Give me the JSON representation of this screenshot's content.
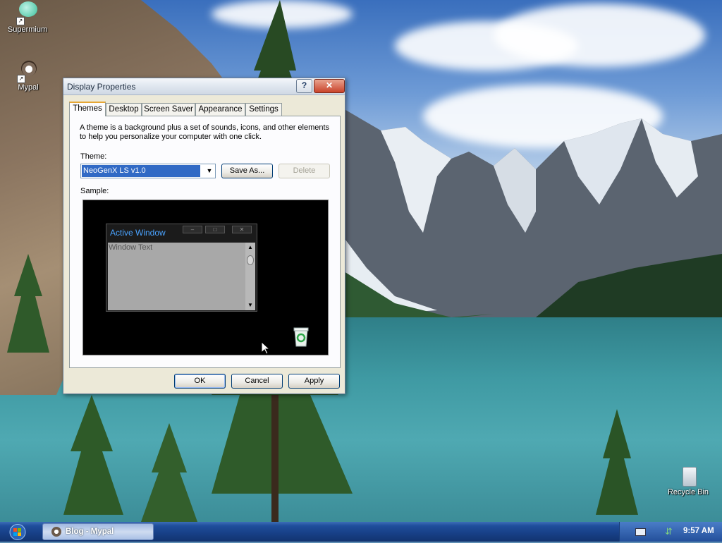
{
  "desktop": {
    "icons": [
      {
        "label": "Supermium",
        "icon": "supermium-browser-icon"
      },
      {
        "label": "Mypal",
        "icon": "mypal-browser-icon"
      },
      {
        "label": "Recycle Bin",
        "icon": "recycle-bin-icon"
      }
    ]
  },
  "dialog": {
    "title": "Display Properties",
    "help_label": "?",
    "close_label": "✕",
    "tabs": [
      {
        "label": "Themes",
        "active": true
      },
      {
        "label": "Desktop",
        "active": false
      },
      {
        "label": "Screen Saver",
        "active": false
      },
      {
        "label": "Appearance",
        "active": false
      },
      {
        "label": "Settings",
        "active": false
      }
    ],
    "description": "A theme is a background plus a set of sounds, icons, and other elements to help you personalize your computer with one click.",
    "theme_label": "Theme:",
    "theme_value": "NeoGenX LS v1.0",
    "save_as_label": "Save As...",
    "delete_label": "Delete",
    "sample_label": "Sample:",
    "sample": {
      "window_title": "Active Window",
      "window_text": "Window Text"
    },
    "ok_label": "OK",
    "cancel_label": "Cancel",
    "apply_label": "Apply"
  },
  "taskbar": {
    "task_label": "Blog - Mypal",
    "clock": "9:57 AM"
  },
  "colors": {
    "accent_selection": "#316ac5",
    "taskbar": "#1f4e9c",
    "sample_title": "#4aa3ff"
  }
}
